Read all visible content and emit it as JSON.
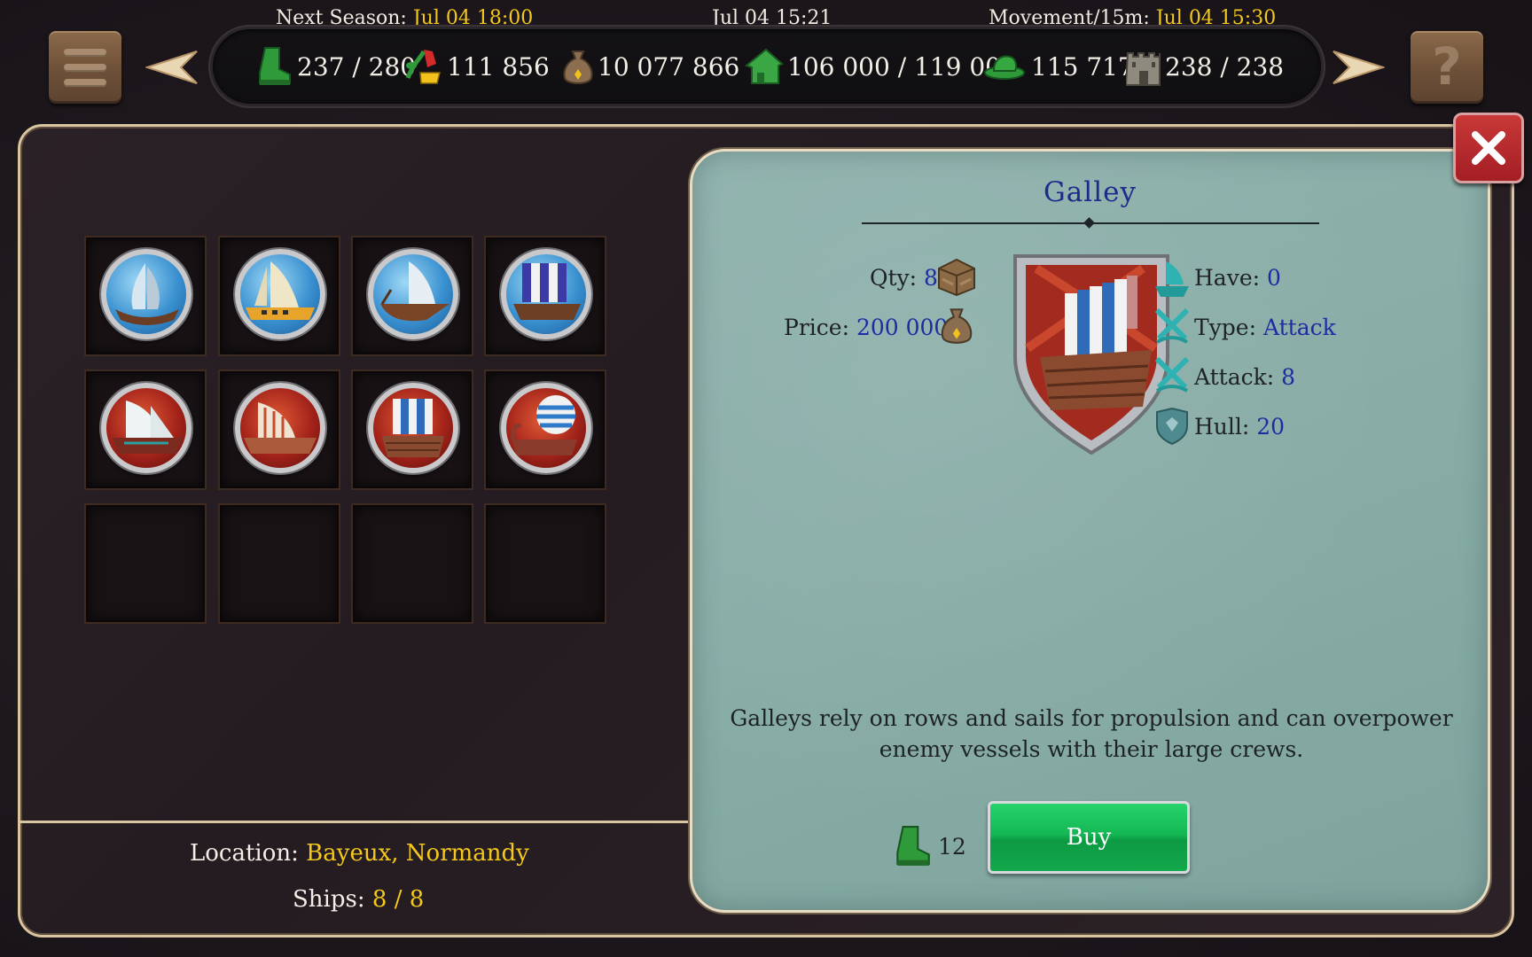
{
  "header": {
    "next_season_label": "Next Season:",
    "next_season_value": "Jul 04 18:00",
    "clock": "Jul 04 15:21",
    "movement_label": "Movement/15m:",
    "movement_value": "Jul 04 15:30"
  },
  "resources": [
    {
      "icon": "boot-icon",
      "value": "237 / 280"
    },
    {
      "icon": "food-icon",
      "value": "111 856"
    },
    {
      "icon": "money-bag-icon",
      "value": "10 077 866"
    },
    {
      "icon": "house-icon",
      "value": "106 000 / 119 000"
    },
    {
      "icon": "hat-icon",
      "value": "115 717"
    },
    {
      "icon": "castle-icon",
      "value": "238 / 238"
    }
  ],
  "help_label": "?",
  "ships": [
    {
      "name": "ship-1",
      "theme": "blue"
    },
    {
      "name": "ship-2",
      "theme": "blue"
    },
    {
      "name": "ship-3",
      "theme": "blue"
    },
    {
      "name": "ship-4",
      "theme": "blue"
    },
    {
      "name": "ship-5",
      "theme": "red"
    },
    {
      "name": "ship-6",
      "theme": "red"
    },
    {
      "name": "galley",
      "theme": "red"
    },
    {
      "name": "ship-8",
      "theme": "red"
    }
  ],
  "empty_slots": 4,
  "location": {
    "label": "Location:",
    "value": "Bayeux, Normandy"
  },
  "ships_count": {
    "label": "Ships:",
    "value": "8 / 8"
  },
  "detail": {
    "title": "Galley",
    "qty_label": "Qty:",
    "qty_value": "8",
    "price_label": "Price:",
    "price_value": "200 000",
    "have_label": "Have:",
    "have_value": "0",
    "type_label": "Type:",
    "type_value": "Attack",
    "attack_label": "Attack:",
    "attack_value": "8",
    "hull_label": "Hull:",
    "hull_value": "20",
    "description": "Galleys rely on rows and sails for propulsion and can overpower enemy vessels with their large crews.",
    "cost_value": "12",
    "buy_label": "Buy"
  },
  "colors": {
    "highlight": "#f4c81c",
    "stat_value": "#1f2ba3",
    "buy_green": "#14b854",
    "close_red": "#a41e24"
  }
}
